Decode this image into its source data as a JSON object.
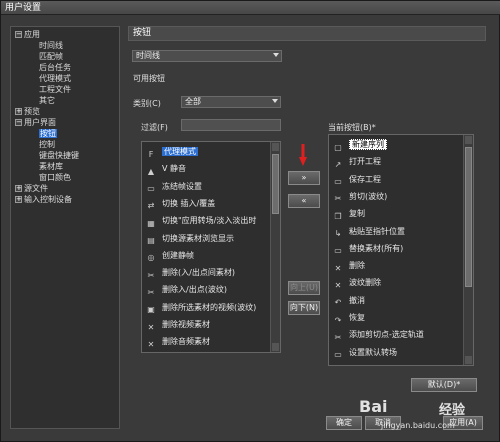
{
  "window": {
    "title": "用户设置"
  },
  "tree": {
    "items": [
      {
        "label": "应用",
        "box": "−",
        "level": 0
      },
      {
        "label": "时间线",
        "level": 1
      },
      {
        "label": "匹配帧",
        "level": 1
      },
      {
        "label": "后台任务",
        "level": 1
      },
      {
        "label": "代理模式",
        "level": 1
      },
      {
        "label": "工程文件",
        "level": 1
      },
      {
        "label": "其它",
        "level": 1
      },
      {
        "label": "预览",
        "box": "+",
        "level": 0
      },
      {
        "label": "用户界面",
        "box": "−",
        "level": 0
      },
      {
        "label": "按钮",
        "level": 1,
        "selected": true
      },
      {
        "label": "控制",
        "level": 1
      },
      {
        "label": "键盘快捷键",
        "level": 1
      },
      {
        "label": "素材库",
        "level": 1
      },
      {
        "label": "窗口颜色",
        "level": 1
      },
      {
        "label": "源文件",
        "box": "+",
        "level": 0
      },
      {
        "label": "输入控制设备",
        "box": "+",
        "level": 0
      }
    ]
  },
  "panel": {
    "header": "按钮",
    "target_select": "时间线",
    "available_label": "可用按钮",
    "category_label": "类别(C)",
    "category_value": "全部",
    "filter_label": "过滤(F)",
    "current_label": "当前按钮(B)*"
  },
  "available_list": [
    {
      "icon": "F",
      "label": "代理模式",
      "state": "hl"
    },
    {
      "icon": "▲",
      "label": "V 静音"
    },
    {
      "icon": "▭",
      "label": "冻结帧设置"
    },
    {
      "icon": "⇄",
      "label": "切换 插入/覆盖"
    },
    {
      "icon": "▦",
      "label": "切换\"应用转场/淡入淡出时"
    },
    {
      "icon": "▤",
      "label": "切换源素材浏览显示"
    },
    {
      "icon": "◎",
      "label": "创建静帧"
    },
    {
      "icon": "✂",
      "label": "删除(入/出点间素材)"
    },
    {
      "icon": "✂",
      "label": "删除入/出点(波纹)"
    },
    {
      "icon": "▣",
      "label": "删除所选素材的视频(波纹)"
    },
    {
      "icon": "✕",
      "label": "删除视频素材"
    },
    {
      "icon": "✕",
      "label": "删除音频素材"
    }
  ],
  "current_list": [
    {
      "icon": "▢",
      "label": "新建序列",
      "state": "selected"
    },
    {
      "icon": "↗",
      "label": "打开工程"
    },
    {
      "icon": "▭",
      "label": "保存工程"
    },
    {
      "icon": "✂",
      "label": "剪切(波纹)"
    },
    {
      "icon": "❐",
      "label": "复制"
    },
    {
      "icon": "↳",
      "label": "粘贴至指针位置"
    },
    {
      "icon": "▭",
      "label": "替换素材(所有)"
    },
    {
      "icon": "✕",
      "label": "删除"
    },
    {
      "icon": "✕",
      "label": "波纹删除"
    },
    {
      "icon": "↶",
      "label": "撤消"
    },
    {
      "icon": "↷",
      "label": "恢复"
    },
    {
      "icon": "✂",
      "label": "添加剪切点-选定轨道"
    },
    {
      "icon": "▭",
      "label": "设置默认转场"
    }
  ],
  "buttons": {
    "add": "»",
    "remove": "«",
    "move_up": "向上(U)",
    "move_down": "向下(N)",
    "default": "默认(D)*",
    "ok": "确定",
    "cancel": "取消",
    "apply": "应用(A)"
  },
  "watermark": {
    "brand": "Bai",
    "brand_cn": "经验",
    "site": "jingyan.baidu.com"
  },
  "colors": {
    "selection": "#2d6fd1",
    "arrow": "#e02020"
  }
}
